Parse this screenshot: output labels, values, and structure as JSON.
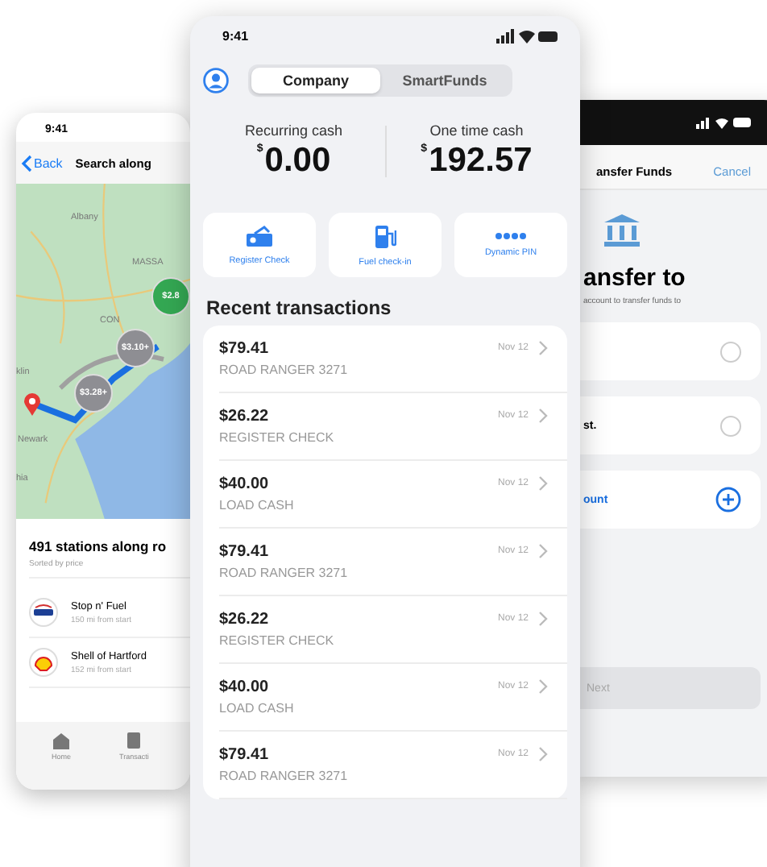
{
  "left_phone": {
    "status_time": "9:41",
    "back": "Back",
    "title": "Search along",
    "map": {
      "labels": [
        "Albany",
        "MASSA",
        "CON",
        "klin",
        "Newark",
        "hia"
      ],
      "pins": [
        {
          "text": "$3.28+",
          "color": "#8e8e93"
        },
        {
          "text": "$3.10+",
          "color": "#8e8e93"
        },
        {
          "text": "$2.8",
          "color": "#34a853"
        }
      ]
    },
    "list_title": "491 stations along ro",
    "list_subtitle": "Sorted by price",
    "stations": [
      {
        "name": "Stop n' Fuel",
        "distance": "150 mi from start",
        "kind": "stop"
      },
      {
        "name": "Shell of Hartford",
        "distance": "152 mi from start",
        "kind": "shell"
      }
    ],
    "tabs": [
      {
        "label": "Home"
      },
      {
        "label": "Transacti"
      }
    ]
  },
  "main_phone": {
    "status_time": "9:41",
    "segments": [
      {
        "label": "Company",
        "selected": true
      },
      {
        "label": "SmartFunds",
        "selected": false
      }
    ],
    "balances": [
      {
        "label": "Recurring cash",
        "currency": "$",
        "amount": "0.00"
      },
      {
        "label": "One time cash",
        "currency": "$",
        "amount": "192.57"
      }
    ],
    "actions": [
      {
        "label": "Register Check"
      },
      {
        "label": "Fuel check-in"
      },
      {
        "label": "Dynamic PIN"
      }
    ],
    "section_title": "Recent transactions",
    "transactions": [
      {
        "amount": "$79.41",
        "merchant": "ROAD RANGER 3271",
        "date": "Nov 12"
      },
      {
        "amount": "$26.22",
        "merchant": "REGISTER CHECK",
        "date": "Nov 12"
      },
      {
        "amount": "$40.00",
        "merchant": "LOAD CASH",
        "date": "Nov 12"
      },
      {
        "amount": "$79.41",
        "merchant": "ROAD RANGER 3271",
        "date": "Nov 12"
      },
      {
        "amount": "$26.22",
        "merchant": "REGISTER CHECK",
        "date": "Nov 12"
      },
      {
        "amount": "$40.00",
        "merchant": "LOAD CASH",
        "date": "Nov 12"
      },
      {
        "amount": "$79.41",
        "merchant": "ROAD RANGER 3271",
        "date": "Nov 12"
      }
    ]
  },
  "right_phone": {
    "title": "ansfer Funds",
    "cancel": "Cancel",
    "heading": "ansfer to",
    "subtitle": "account to transfer funds to",
    "options": [
      {
        "kind": "radio",
        "selected": false
      },
      {
        "kind": "radio",
        "label": "st.",
        "selected": false
      },
      {
        "kind": "add",
        "label": "ount"
      }
    ],
    "next": {
      "label": "Next",
      "disabled": true
    }
  }
}
